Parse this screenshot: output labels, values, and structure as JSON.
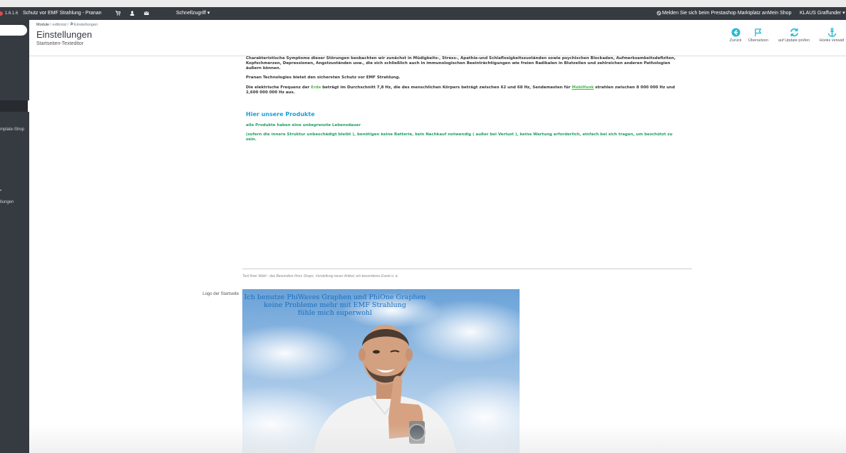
{
  "topbar": {
    "version": "1.6.1.6",
    "shop_title": "Schutz vor EMF Strahlung - Pranan",
    "quick_access": "Schnellzugriff ▾",
    "marketplace_link": "Melden Sie sich beim Prestashop Marktplatz an",
    "my_shop": "Mein Shop",
    "user_menu": "KLAUS Graffunder ▾"
  },
  "sidebar": {
    "item_template_shop": "mplate-Shop",
    "item_einstellungen": "llungen"
  },
  "header": {
    "breadcrumb_module": "Module",
    "breadcrumb_sep1": "/",
    "breadcrumb_editorial": "editorial",
    "breadcrumb_sep2": "/",
    "breadcrumb_current": "Einstellungen",
    "title": "Einstellungen",
    "subtitle": "Startseiten-Texteditor"
  },
  "toolbar": {
    "back": "Zurück",
    "translate": "Übersetzen",
    "update_check": "auf Update prüfen",
    "hooks": "Hooks verwalt"
  },
  "content": {
    "para1": "Charakteristische Symptome dieser Störungen beobachten wir zunächst in Müdigkeits-, Stress-, Apathie-und Schlaflosigkeitszuständen sowie psychischen Blockaden, Aufmerksamkeitsdefiziten, Kopfschmerzen, Depressionen, Angstzuständen usw., die sich schließlich auch in immunologischen Beeinträchtigungen wie freien Radikalen in Blutzellen und zahlreichen anderen Pathologien äußern können.",
    "para2": "Pranan Technologies bietet den sichersten Schutz vor EMF Strahlung.",
    "para3_a": "Die elektrische Frequenz der ",
    "para3_erde": "Erde",
    "para3_b": " beträgt im Durchschnitt 7,8 Hz, die des menschlichen Körpers beträgt zwischen 62 und 68 Hz,  Sendemasten für ",
    "para3_link": "Mobilfunk",
    "para3_c": " strahlen  zwischen 8 000 000 Hz und 2,600 000 000 Hz aus.",
    "heading": "Hier unsere Produkte",
    "line1_a": "alle Produkte haben eine ",
    "line1_em": "unbegrenzte",
    "line1_b": " Lebensdauer",
    "line2": "(sofern die innere Struktur unbeschädigt bleibt ), benötigen keine Batterie, kein Nachkauf notwendig ( außer bei Verlust ), keine Wartung erforderlich, einfach bei sich tragen, um beschützt zu sein.",
    "help_text": "Text Ihrer Wahl - das Besondere Ihres Shops, Vorstellung neuer Artikel, ein besonderes Event o. ä.",
    "logo_label": "Logo der Startseite",
    "image_text_1": "Ich benutze PhiWaves Graphen und PhiOne Graphen",
    "image_text_2": "keine Probleme mehr mit EMF Strahlung",
    "image_text_3": "fühle mich superwohl"
  },
  "colors": {
    "topbar": "#363a41",
    "accent": "#25b9d7",
    "heading_blue": "#1aa0dc",
    "green": "#1ea063"
  }
}
